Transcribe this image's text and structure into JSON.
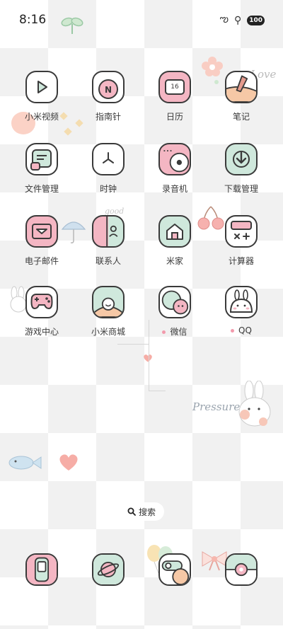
{
  "status_bar": {
    "time": "8:16",
    "battery": "100"
  },
  "decor": {
    "love": "Love",
    "good": "good",
    "pressure": "Pressure"
  },
  "apps": [
    {
      "label": "小米视频",
      "icon": "video-play-icon"
    },
    {
      "label": "指南针",
      "icon": "compass-icon"
    },
    {
      "label": "日历",
      "icon": "calendar-icon",
      "day": "16"
    },
    {
      "label": "笔记",
      "icon": "notes-icon"
    },
    {
      "label": "文件管理",
      "icon": "file-manager-icon"
    },
    {
      "label": "时钟",
      "icon": "clock-icon"
    },
    {
      "label": "录音机",
      "icon": "recorder-icon"
    },
    {
      "label": "下载管理",
      "icon": "download-icon"
    },
    {
      "label": "电子邮件",
      "icon": "email-icon"
    },
    {
      "label": "联系人",
      "icon": "contacts-icon"
    },
    {
      "label": "米家",
      "icon": "home-icon"
    },
    {
      "label": "计算器",
      "icon": "calculator-icon"
    },
    {
      "label": "游戏中心",
      "icon": "gamepad-icon"
    },
    {
      "label": "小米商城",
      "icon": "store-icon"
    },
    {
      "label": "微信",
      "icon": "wechat-icon",
      "new": true
    },
    {
      "label": "QQ",
      "icon": "qq-icon",
      "new": true
    }
  ],
  "search": {
    "label": "搜索"
  },
  "dock": [
    {
      "icon": "phone-icon"
    },
    {
      "icon": "browser-icon"
    },
    {
      "icon": "settings-toggle-icon"
    },
    {
      "icon": "camera-icon"
    }
  ],
  "colors": {
    "pink": "#f4b6c3",
    "mint": "#cfe8dc",
    "outline": "#3a3a3a"
  }
}
